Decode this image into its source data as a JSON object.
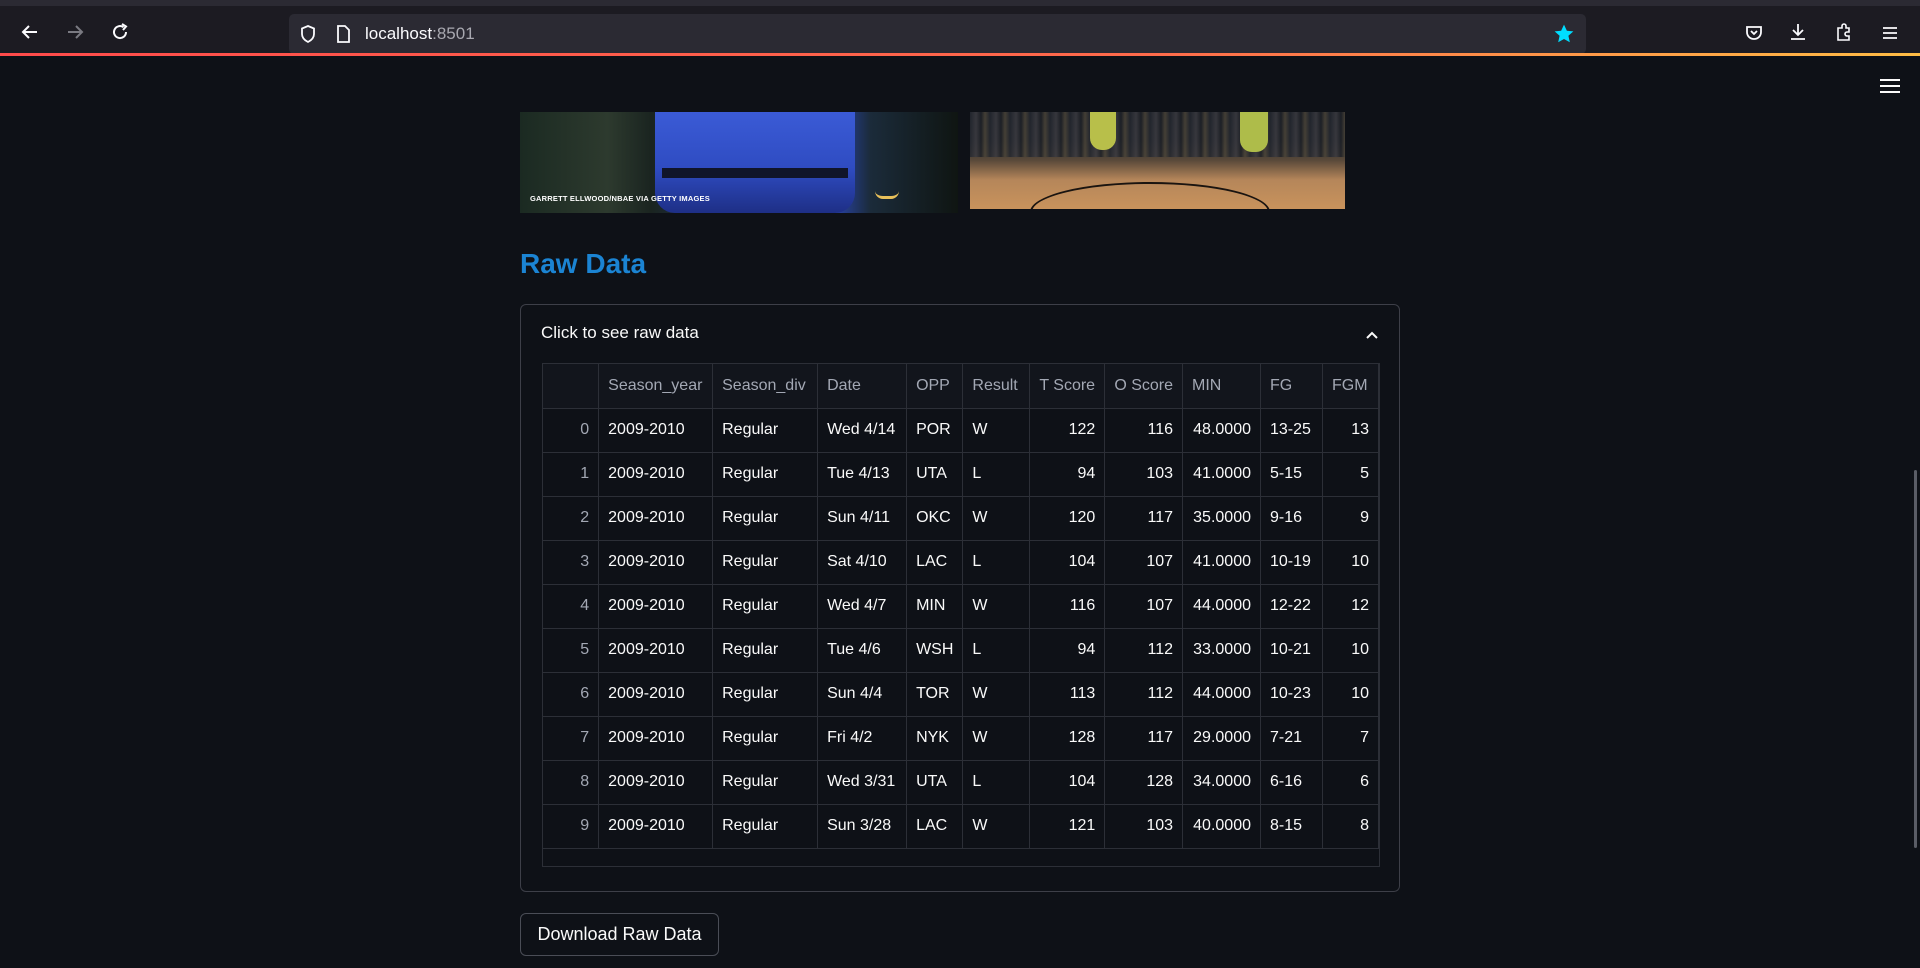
{
  "browser": {
    "url_host": "localhost",
    "url_port": ":8501"
  },
  "image_caption": "GARRETT ELLWOOD/NBAE VIA GETTY IMAGES",
  "section_title": "Raw Data",
  "expander": {
    "label": "Click to see raw data"
  },
  "table": {
    "columns": [
      "",
      "Season_year",
      "Season_div",
      "Date",
      "OPP",
      "Result",
      "T Score",
      "O Score",
      "MIN",
      "FG",
      "FGM"
    ],
    "rows": [
      [
        "0",
        "2009-2010",
        "Regular",
        "Wed 4/14",
        "POR",
        "W",
        "122",
        "116",
        "48.0000",
        "13-25",
        "13"
      ],
      [
        "1",
        "2009-2010",
        "Regular",
        "Tue 4/13",
        "UTA",
        "L",
        "94",
        "103",
        "41.0000",
        "5-15",
        "5"
      ],
      [
        "2",
        "2009-2010",
        "Regular",
        "Sun 4/11",
        "OKC",
        "W",
        "120",
        "117",
        "35.0000",
        "9-16",
        "9"
      ],
      [
        "3",
        "2009-2010",
        "Regular",
        "Sat 4/10",
        "LAC",
        "L",
        "104",
        "107",
        "41.0000",
        "10-19",
        "10"
      ],
      [
        "4",
        "2009-2010",
        "Regular",
        "Wed 4/7",
        "MIN",
        "W",
        "116",
        "107",
        "44.0000",
        "12-22",
        "12"
      ],
      [
        "5",
        "2009-2010",
        "Regular",
        "Tue 4/6",
        "WSH",
        "L",
        "94",
        "112",
        "33.0000",
        "10-21",
        "10"
      ],
      [
        "6",
        "2009-2010",
        "Regular",
        "Sun 4/4",
        "TOR",
        "W",
        "113",
        "112",
        "44.0000",
        "10-23",
        "10"
      ],
      [
        "7",
        "2009-2010",
        "Regular",
        "Fri 4/2",
        "NYK",
        "W",
        "128",
        "117",
        "29.0000",
        "7-21",
        "7"
      ],
      [
        "8",
        "2009-2010",
        "Regular",
        "Wed 3/31",
        "UTA",
        "L",
        "104",
        "128",
        "34.0000",
        "6-16",
        "6"
      ],
      [
        "9",
        "2009-2010",
        "Regular",
        "Sun 3/28",
        "LAC",
        "W",
        "121",
        "103",
        "40.0000",
        "8-15",
        "8"
      ]
    ]
  },
  "download_button": {
    "label": "Download Raw Data"
  }
}
